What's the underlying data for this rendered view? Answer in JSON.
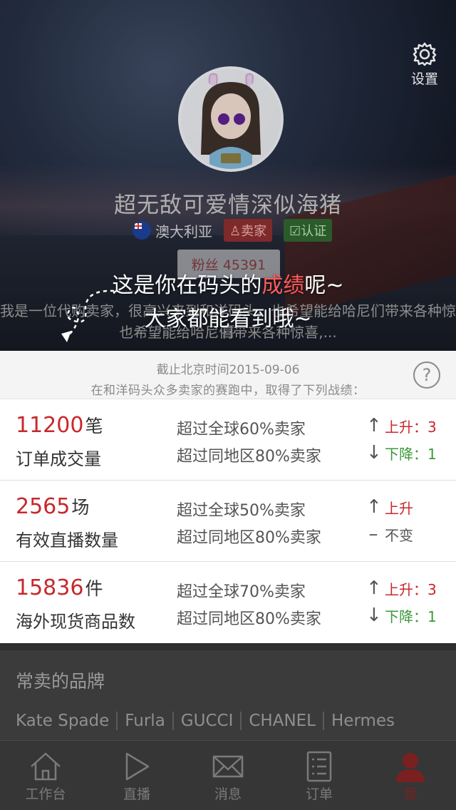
{
  "header": {
    "settings_label": "设置",
    "username": "超无敌可爱情深似海猪",
    "country": "澳大利亚",
    "badge_seller": "卖家",
    "badge_cert": "认证",
    "fans_label": "粉丝 45391",
    "intro_line1": "我是一位代购卖家，很高兴来到和洋码头。也希望能给哈尼们带来各种惊喜",
    "intro_line2": "也希望能给哈尼们带来各种惊喜,..."
  },
  "guide": {
    "line1_prefix": "这是你在码头的",
    "line1_highlight": "成绩",
    "line1_suffix": "呢~",
    "line2": "大家都能看到哦~"
  },
  "stats": {
    "as_of": "截止北京时间2015-09-06",
    "subtitle": "在和洋码头众多卖家的赛跑中，取得了下列战绩：",
    "help_icon": "?",
    "rows": [
      {
        "value": "11200",
        "unit": "笔",
        "label": "订单成交量",
        "cmp_global": "超过全球60%卖家",
        "cmp_region": "超过同地区80%卖家",
        "trend_global": "上升：3",
        "trend_region": "下降：1"
      },
      {
        "value": "2565",
        "unit": "场",
        "label": "有效直播数量",
        "cmp_global": "超过全球50%卖家",
        "cmp_region": "超过同地区80%卖家",
        "trend_global": "上升",
        "trend_region": "不变"
      },
      {
        "value": "15836",
        "unit": "件",
        "label": "海外现货商品数",
        "cmp_global": "超过全球70%卖家",
        "cmp_region": "超过同地区80%卖家",
        "trend_global": "上升：3",
        "trend_region": "下降：1"
      }
    ]
  },
  "brands": {
    "title": "常卖的品牌",
    "items": [
      "Kate Spade",
      "Furla",
      "GUCCI",
      "CHANEL",
      "Hermes"
    ]
  },
  "tabbar": {
    "items": [
      "工作台",
      "直播",
      "消息",
      "订单",
      "我"
    ],
    "active": "我"
  },
  "colors": {
    "accent_red": "#c8282c",
    "trend_up": "#c8282c",
    "trend_down": "#3a9a3a"
  }
}
